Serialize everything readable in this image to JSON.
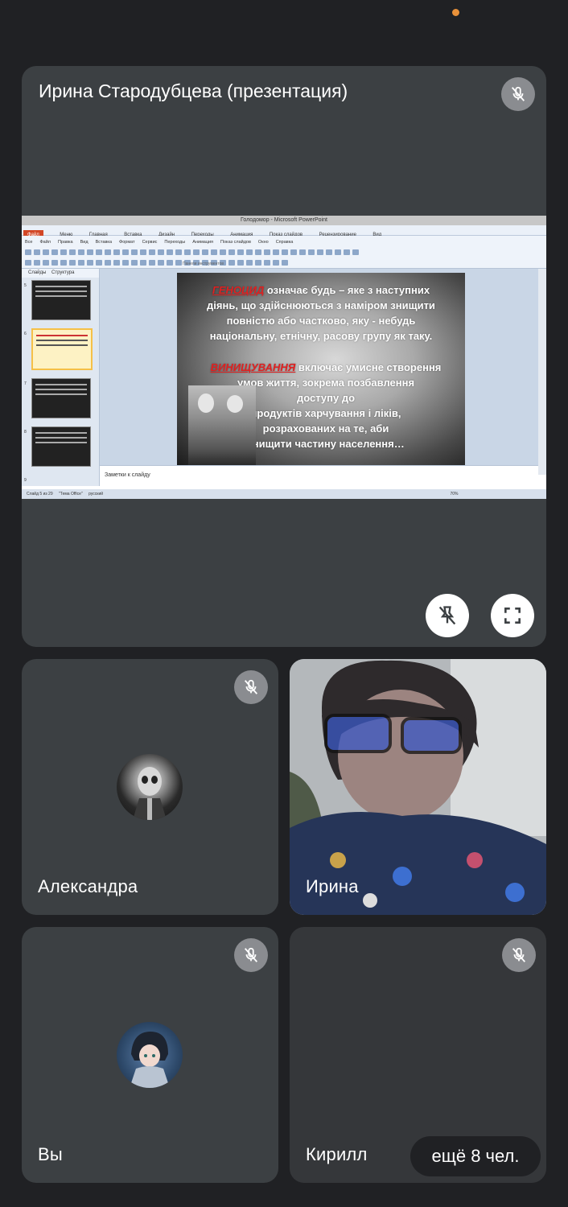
{
  "presenter": {
    "title": "Ирина Стародубцева (презентация)",
    "mic_state": "muted",
    "controls": {
      "unpin": "unpin-icon",
      "fullscreen": "fullscreen-icon"
    }
  },
  "shared_screen": {
    "window_title": "Голодомор - Microsoft PowerPoint",
    "menu": [
      "Файл",
      "Меню",
      "Главная",
      "Вставка",
      "Дизайн",
      "Переходы",
      "Анимация",
      "Показ слайдов",
      "Рецензирование",
      "Вид"
    ],
    "ribbon_menu": [
      "Все",
      "Файл",
      "Правка",
      "Вид",
      "Вставка",
      "Формат",
      "Сервис",
      "Переходы",
      "Анимация",
      "Показ слайдов",
      "Окно",
      "Справка"
    ],
    "ribbon_caption": "Панели инструментов",
    "side_tabs": [
      "Слайды",
      "Структура"
    ],
    "slide_numbers": [
      "5",
      "6",
      "7",
      "8",
      "9"
    ],
    "slide": {
      "term1": "ГЕНОЦИД",
      "text1_line1": " означає будь – яке з наступних",
      "text1_lines": [
        "діянь, що здійснюються з наміром знищити",
        "повністю або частково, яку - небудь",
        "національну, етнічну, расову групу як таку."
      ],
      "term2": "ВИНИЩУВАННЯ",
      "text2_line1": " включає умисне створення",
      "text2_lines": [
        "умов життя, зокрема позбавлення",
        "доступу до",
        "продуктів харчування і ліків,",
        "розрахованих на те, аби",
        "знищити частину населення…"
      ]
    },
    "notes_placeholder": "Заметки к слайду",
    "status": {
      "slide": "Слайд 5 из 29",
      "theme": "\"Тема Office\"",
      "lang": "русский",
      "zoom": "70%"
    }
  },
  "participants": [
    {
      "name": "Александра",
      "mic_state": "muted",
      "avatar": "avatar-skull-icon"
    },
    {
      "name": "Ирина",
      "mic_state": "on",
      "video": true
    },
    {
      "name": "Вы",
      "mic_state": "muted",
      "avatar": "avatar-anime-icon"
    },
    {
      "name": "Кирилл",
      "mic_state": "muted"
    }
  ],
  "more_label": "ещё 8 чел.",
  "colors": {
    "background": "#202124",
    "tile": "#3c4043",
    "accent_dot": "#e8913a"
  }
}
